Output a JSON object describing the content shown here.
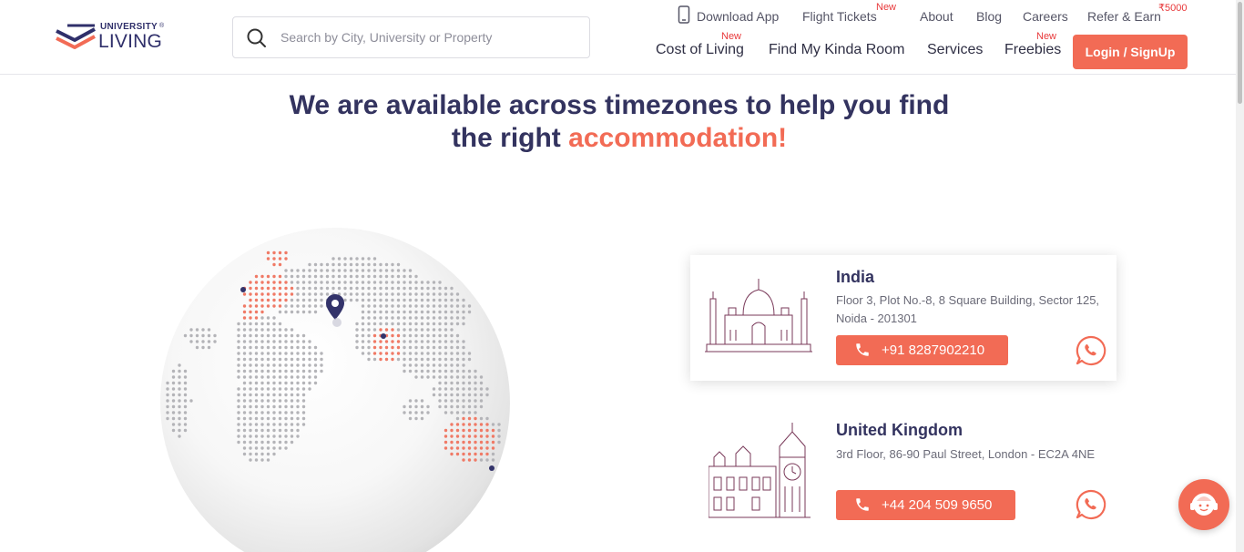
{
  "brand": {
    "top": "UNIVERSITY",
    "bottom": "LIVING",
    "reg": "®"
  },
  "search": {
    "placeholder": "Search by City, University or Property"
  },
  "top_nav": {
    "download_app": "Download App",
    "flight_tickets": "Flight Tickets",
    "flight_new": "New",
    "about": "About",
    "blog": "Blog",
    "careers": "Careers",
    "refer_earn": "Refer & Earn",
    "refer_amount": "₹5000"
  },
  "main_nav": {
    "cost_of_living": "Cost of Living",
    "cost_new": "New",
    "find_room": "Find My Kinda Room",
    "services": "Services",
    "freebies": "Freebies",
    "freebies_new": "New",
    "login": "Login / SignUp"
  },
  "heading": {
    "line1": "We are available across timezones to help you find",
    "line2_plain": "the right ",
    "line2_accent": "accommodation!"
  },
  "offices": [
    {
      "country": "India",
      "address": "Floor 3, Plot No.-8, 8 Square Building, Sector 125, Noida - 201301",
      "phone": "+91 8287902210",
      "icon": "taj-mahal-icon"
    },
    {
      "country": "United Kingdom",
      "address": "3rd Floor, 86-90 Paul Street, London - EC2A 4NE",
      "phone": "+44 204 509 9650",
      "icon": "big-ben-icon"
    }
  ],
  "colors": {
    "accent": "#f26b55",
    "navy": "#33335f",
    "new_tag": "#e8383a",
    "whatsapp": "#f26b55"
  }
}
